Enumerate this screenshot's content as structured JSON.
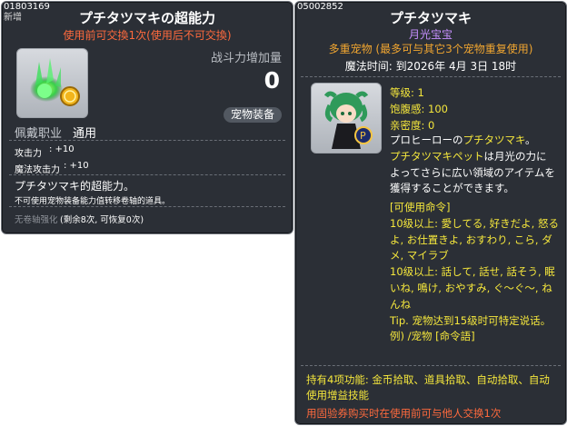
{
  "left_card": {
    "item_id": "01803169",
    "new_tag": "新增",
    "title": "プチタツマキの超能力",
    "trade_note": "使用前可交換1次(使用后不可交換)",
    "power_label": "战斗力增加量",
    "power_value": "0",
    "category_pill": "宠物装备",
    "job_label": "佩戴职业",
    "job_value": "通用",
    "stats": [
      {
        "label": "攻击力",
        "value": ": +10"
      },
      {
        "label": "魔法攻击力",
        "value": ": +10"
      }
    ],
    "desc_title": "プチタツマキ的超能力。",
    "desc_note": "不可使用宠物装备能力值转移卷轴的道具。",
    "upgrade_label": "无卷轴强化",
    "upgrade_value": "(剩余8次, 可恢复0次)"
  },
  "right_card": {
    "item_id": "05002852",
    "title": "プチタツマキ",
    "subtitle": "月光宝宝",
    "multi_pet": "多重宠物 (最多可与其它3个宠物重复使用)",
    "magic_time": "魔法时间: 到2026年 4月 3日 18时",
    "level": "等级: 1",
    "fullness": "饱腹感: 100",
    "intimacy": "亲密度: 0",
    "description": [
      {
        "text": "プロヒーローの",
        "color": "white"
      },
      {
        "text": "プチタツマキ",
        "color": "yellow"
      },
      {
        "text": "。",
        "color": "white"
      }
    ],
    "desc_line2": [
      {
        "text": "プチタツマキペット",
        "color": "yellow"
      },
      {
        "text": "は月光の力に",
        "color": "white"
      }
    ],
    "desc_rest": "よってさらに広い領域のアイテムを獲得することができます。",
    "commands_header": "[可使用命令]",
    "commands_1": "10级以上: 愛してる, 好きだよ, 怒るよ, お仕置きよ, おすわり, こら, ダメ, マイラブ",
    "commands_2": "10级以上: 話して, 話せ, 話そう, 眠いね, 鳴け, おやすみ, ぐ〜ぐ〜, ねんね",
    "tip": "Tip. 宠物达到15级时可特定说话。",
    "example": "例) /宠物 [命令語]",
    "abilities": "持有4项功能: 金币拾取、道具拾取、自动拾取、自动使用增益技能",
    "trade_note": "用固验券购买时在使用前可与他人交换1次"
  },
  "colors": {
    "panel_bg": "#2b2f36",
    "yellow": "#f5e73c",
    "orange": "#f0a530",
    "red": "#ff6a3d",
    "purple": "#c790ff"
  }
}
